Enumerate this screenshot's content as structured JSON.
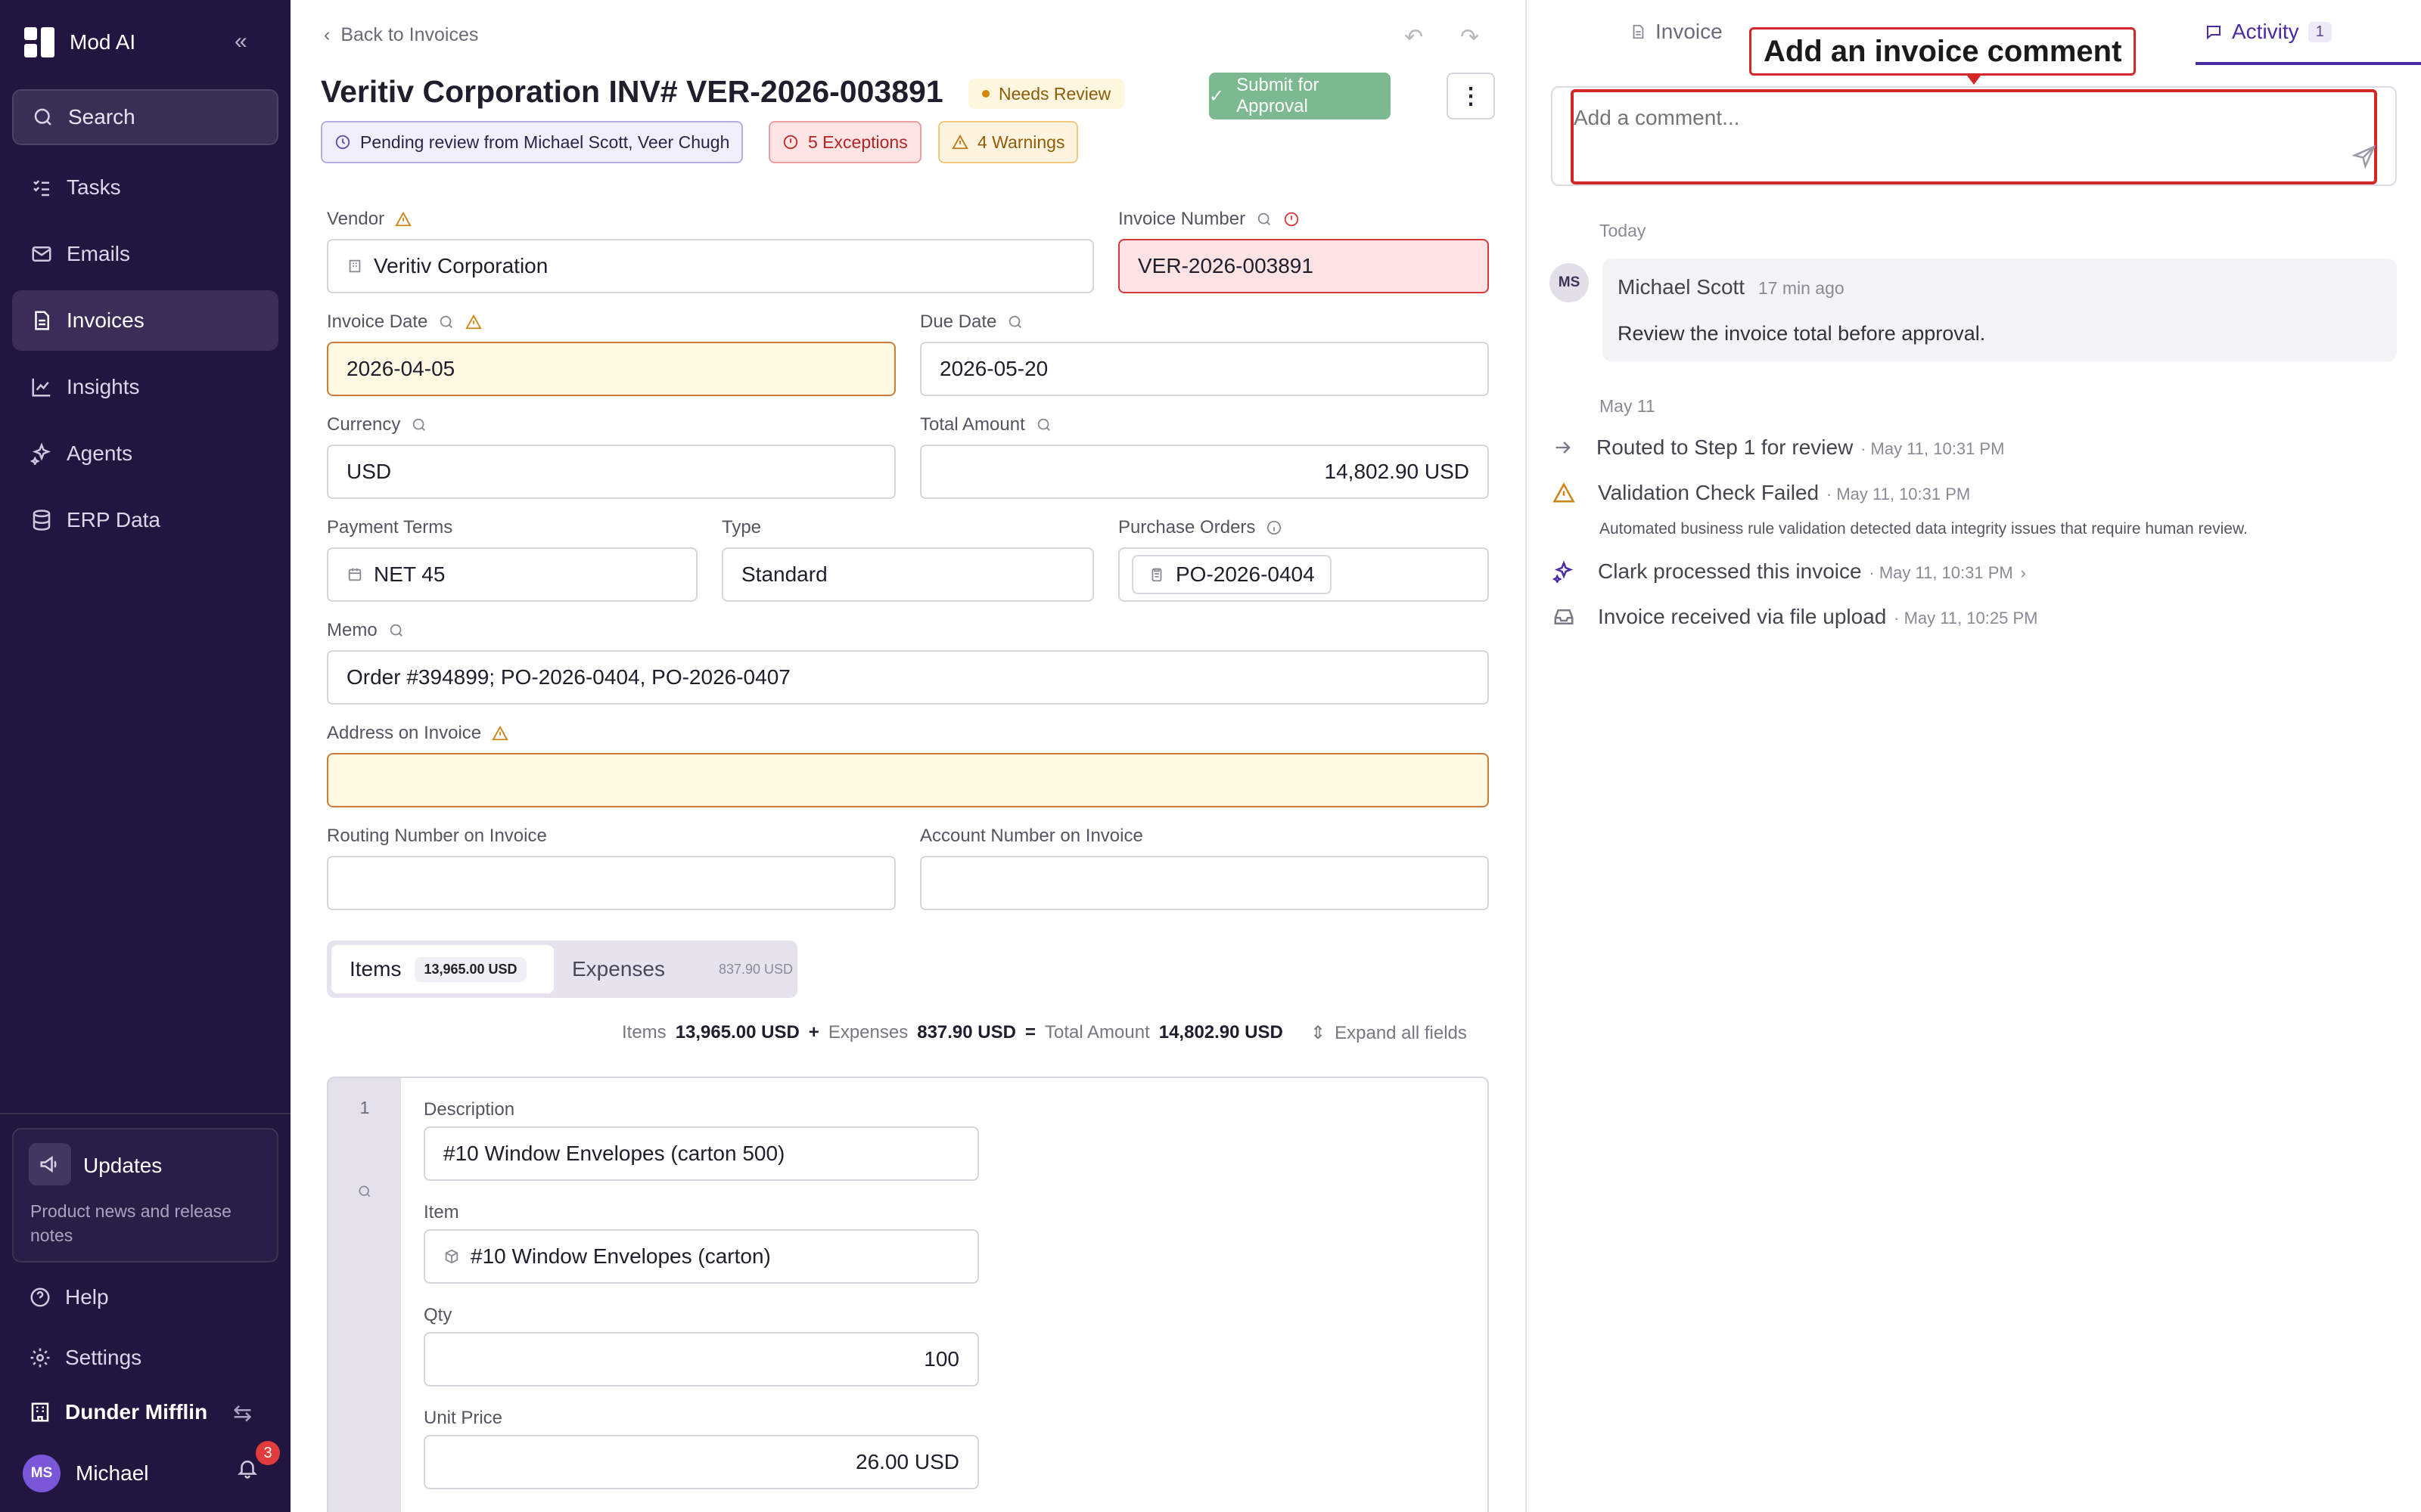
{
  "app": {
    "name": "Mod AI"
  },
  "sidebar": {
    "search_label": "Search",
    "items": [
      {
        "label": "Tasks",
        "icon": "tasks-icon"
      },
      {
        "label": "Emails",
        "icon": "mail-icon"
      },
      {
        "label": "Invoices",
        "icon": "invoice-icon",
        "active": true
      },
      {
        "label": "Insights",
        "icon": "chart-line-icon"
      },
      {
        "label": "Agents",
        "icon": "sparkles-icon"
      },
      {
        "label": "ERP Data",
        "icon": "database-icon"
      }
    ],
    "updates": {
      "title": "Updates",
      "description": "Product news and release notes"
    },
    "help_label": "Help",
    "settings_label": "Settings",
    "org_name": "Dunder Mifflin",
    "user": {
      "initials": "MS",
      "name": "Michael",
      "notifications": "3"
    }
  },
  "header": {
    "back_label": "Back to Invoices",
    "title": "Veritiv Corporation INV# VER-2026-003891",
    "status": "Needs Review",
    "submit_label": "Submit for Approval",
    "chips": {
      "pending": "Pending review from Michael Scott, Veer Chugh",
      "exceptions": "5 Exceptions",
      "warnings": "4 Warnings"
    }
  },
  "form": {
    "vendor": {
      "label": "Vendor",
      "value": "Veritiv Corporation"
    },
    "invoice_number": {
      "label": "Invoice Number",
      "value": "VER-2026-003891"
    },
    "invoice_date": {
      "label": "Invoice Date",
      "value": "2026-04-05"
    },
    "due_date": {
      "label": "Due Date",
      "value": "2026-05-20"
    },
    "currency": {
      "label": "Currency",
      "value": "USD"
    },
    "total_amount": {
      "label": "Total Amount",
      "value": "14,802.90 USD"
    },
    "payment_terms": {
      "label": "Payment Terms",
      "value": "NET 45"
    },
    "type": {
      "label": "Type",
      "value": "Standard"
    },
    "purchase_orders": {
      "label": "Purchase Orders",
      "value": "PO-2026-0404"
    },
    "memo": {
      "label": "Memo",
      "value": "Order #394899; PO-2026-0404, PO-2026-0407"
    },
    "address": {
      "label": "Address on Invoice",
      "value": ""
    },
    "routing": {
      "label": "Routing Number on Invoice",
      "value": ""
    },
    "account": {
      "label": "Account Number on Invoice",
      "value": ""
    }
  },
  "lines": {
    "items_tab": "Items",
    "items_amount": "13,965.00 USD",
    "expenses_tab": "Expenses",
    "expenses_amount": "837.90 USD",
    "totals": {
      "items_label": "Items",
      "items_value": "13,965.00 USD",
      "plus": "+",
      "expenses_label": "Expenses",
      "expenses_value": "837.90 USD",
      "equals": "=",
      "total_label": "Total Amount",
      "total_value": "14,802.90 USD"
    },
    "expand_label": "Expand all fields",
    "item": {
      "number": "1",
      "description_label": "Description",
      "description": "#10 Window Envelopes (carton 500)",
      "item_label": "Item",
      "item": "#10 Window Envelopes (carton)",
      "qty_label": "Qty",
      "qty": "100",
      "unit_price_label": "Unit Price",
      "unit_price": "26.00 USD"
    }
  },
  "panel": {
    "tabs": {
      "invoice": "Invoice",
      "activity": "Activity",
      "activity_count": "1"
    },
    "tooltip": "Add an invoice comment",
    "comment_placeholder": "Add a comment...",
    "today_label": "Today",
    "comment": {
      "initials": "MS",
      "author": "Michael Scott",
      "time": "17 min ago",
      "text": "Review the invoice total before approval."
    },
    "earlier_label": "May 11",
    "activities": [
      {
        "text": "Routed to Step 1 for review",
        "time": "· May 11, 10:31 PM",
        "icon": "arrow-right-icon"
      },
      {
        "text": "Validation Check Failed",
        "time": "· May 11, 10:31 PM",
        "icon": "warning-icon",
        "detail": "Automated business rule validation detected data integrity issues that require human review."
      },
      {
        "text": "Clark processed this invoice",
        "time": "· May 11, 10:31 PM",
        "icon": "sparkles-icon"
      },
      {
        "text": "Invoice received via file upload",
        "time": "· May 11, 10:25 PM",
        "icon": "inbox-icon"
      }
    ]
  }
}
